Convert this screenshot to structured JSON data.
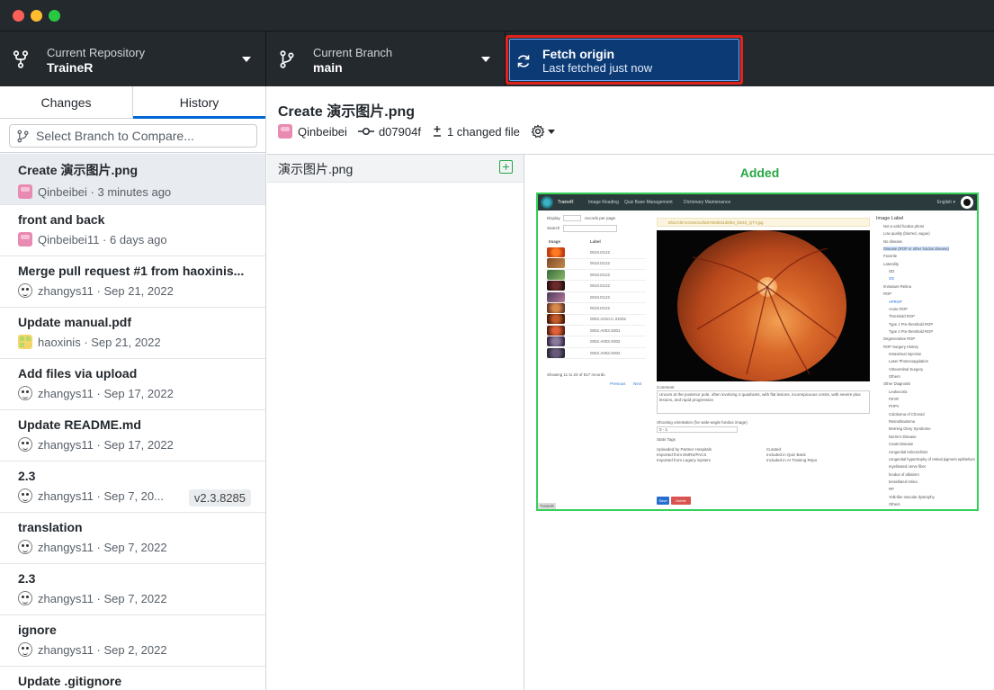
{
  "toolbar": {
    "repo_label": "Current Repository",
    "repo_value": "TraineR",
    "branch_label": "Current Branch",
    "branch_value": "main",
    "fetch_label": "Fetch origin",
    "fetch_status": "Last fetched just now"
  },
  "sidebar": {
    "tabs": [
      "Changes",
      "History"
    ],
    "active_tab": "History",
    "compare_placeholder": "Select Branch to Compare...",
    "commits": [
      {
        "title": "Create 演示图片.png",
        "author": "Qinbeibei",
        "time": "3 minutes ago",
        "avatar": "pink"
      },
      {
        "title": "front and back",
        "author": "Qinbeibei11",
        "time": "6 days ago",
        "avatar": "pink"
      },
      {
        "title": "Merge pull request #1 from haoxinis...",
        "author": "zhangys11",
        "time": "Sep 21, 2022",
        "avatar": "face"
      },
      {
        "title": "Update manual.pdf",
        "author": "haoxinis",
        "time": "Sep 21, 2022",
        "avatar": "yellow"
      },
      {
        "title": "Add files via upload",
        "author": "zhangys11",
        "time": "Sep 17, 2022",
        "avatar": "face"
      },
      {
        "title": "Update README.md",
        "author": "zhangys11",
        "time": "Sep 17, 2022",
        "avatar": "face"
      },
      {
        "title": "2.3",
        "author": "zhangys11",
        "time": "Sep 7, 20...",
        "avatar": "face",
        "tag": "v2.3.8285"
      },
      {
        "title": "translation",
        "author": "zhangys11",
        "time": "Sep 7, 2022",
        "avatar": "face"
      },
      {
        "title": "2.3",
        "author": "zhangys11",
        "time": "Sep 7, 2022",
        "avatar": "face"
      },
      {
        "title": "ignore",
        "author": "zhangys11",
        "time": "Sep 2, 2022",
        "avatar": "face"
      },
      {
        "title": "Update .gitignore",
        "author": "",
        "time": "",
        "avatar": "face"
      }
    ]
  },
  "commit_header": {
    "title": "Create 演示图片.png",
    "author": "Qinbeibei",
    "sha": "d07904f",
    "changed": "1 changed file"
  },
  "file_list": {
    "file_name": "演示图片.png"
  },
  "diff": {
    "status": "Added"
  },
  "preview": {
    "nav_brand": "TraineR",
    "nav_items": [
      "Image Reading",
      "Quiz Base Management",
      "Dictionary Maintenance"
    ],
    "nav_right": "English ▾",
    "display_label": "Display",
    "records_label": "records per page",
    "search_label": "Search",
    "col_image": "Image",
    "col_label": "Label",
    "rows": [
      "0010.D122",
      "0010.D122",
      "0010.D122",
      "0010.D122",
      "0010.D122",
      "0010.D122",
      "0002.A010.C.31002",
      "0002.A003.S001",
      "0002.A003.S002",
      "0002.A003.S002"
    ],
    "showing": "Showing 11 to 20 of 517 records",
    "prev": "Previous",
    "next": "Next",
    "path": "8f4a7d57e316e313fa9780d834d5f94_D040_QTY.jpg",
    "comment_label": "Comment",
    "comment_text": "Uncurs at the posterior pole, often involving 4 quadrants, with flat lesions, inconspicuous crests, with severe plus lesions, and rapid progression",
    "orient_label": "Shooting orientation (for wide-angle fundus image)",
    "orient_value": "0 - 1",
    "stats_label": "Stats Tags",
    "stats": [
      "Uploaded by Partner Hospitals",
      "Imported from EMRS/PACS",
      "Imported from Legacy System",
      "Curated",
      "Included in Quiz Bank",
      "Included in AI Training Repo"
    ],
    "save": "Save",
    "delete": "Delete",
    "footer_tag": "TraineR",
    "tree_title": "Image Label",
    "tree": [
      "Not a valid fundus photo",
      "Low quality (blurred, vague)",
      "No disease",
      "Disease (ROP or other fundus disease)",
      "Favorite",
      "Laterality",
      "OD",
      "OS",
      "Immature Retina",
      "ROP",
      "APROP",
      "Acute ROP",
      "Threshold ROP",
      "Type 1 Pre-threshold ROP",
      "Type 2 Pre-threshold ROP",
      "Degenerative ROP",
      "ROP Surgery History",
      "Intravitreal Injection",
      "Laser Photocoagulation",
      "Vitreoretinal Surgery",
      "Others",
      "Other Diagnosis",
      "Leukocoria",
      "FEVR",
      "PHPV",
      "Coloboma of Choroid",
      "Retinoblastoma",
      "Morning Glory Syndrome",
      "Norrie's Disease",
      "Coats Disease",
      "congenital retinoschisis",
      "congenital hypertrophy of retinal pigment epithelium",
      "myelinated nerve fiber",
      "fundus of albinism",
      "tessellated retina",
      "RP",
      "Yolk-like macular dystrophy",
      "Others"
    ]
  },
  "colors": {
    "toolbar_bg": "#24292e",
    "fetch_bg": "#0b3a75",
    "highlight_border": "#e0241b",
    "tab_accent": "#0366d6",
    "added_green": "#28a745"
  }
}
